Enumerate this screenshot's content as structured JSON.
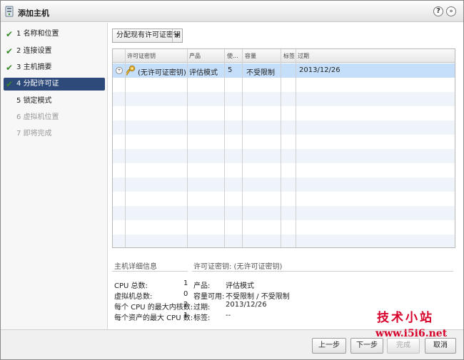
{
  "window": {
    "title": "添加主机",
    "help_icon": "?",
    "expand_icon": "»"
  },
  "steps": [
    {
      "num": "1",
      "label": "名称和位置",
      "state": "done"
    },
    {
      "num": "2",
      "label": "连接设置",
      "state": "done"
    },
    {
      "num": "3",
      "label": "主机摘要",
      "state": "done"
    },
    {
      "num": "4",
      "label": "分配许可证",
      "state": "active"
    },
    {
      "num": "5",
      "label": "锁定模式",
      "state": "pending"
    },
    {
      "num": "6",
      "label": "虚拟机位置",
      "state": "disabled"
    },
    {
      "num": "7",
      "label": "即将完成",
      "state": "disabled"
    }
  ],
  "check_mark": "✔",
  "dropdown": {
    "label": "分配现有许可证密钥",
    "arrow": "▼"
  },
  "grid": {
    "columns": [
      "许可证密钥",
      "产品",
      "使...",
      "容量",
      "标签",
      "过期"
    ],
    "rows": [
      {
        "expander": "+",
        "key": "(无许可证密钥)",
        "product": "评估模式",
        "used": "5",
        "capacity": "不受限制",
        "label": "",
        "expires": "2013/12/26"
      }
    ]
  },
  "host_details": {
    "title": "主机详细信息",
    "items": [
      {
        "label": "CPU 总数:",
        "value": "1"
      },
      {
        "label": "虚拟机总数:",
        "value": "0"
      },
      {
        "label": "每个 CPU 的最大内核数:",
        "value": "2"
      },
      {
        "label": "每个资产的最大 CPU 数:",
        "value": "1"
      }
    ]
  },
  "license_details": {
    "title": "许可证密钥: (无许可证密钥)",
    "items": [
      {
        "label": "产品:",
        "value": "评估模式"
      },
      {
        "label": "容量可用:",
        "value": "不受限制 / 不受限制"
      },
      {
        "label": "过期:",
        "value": "2013/12/26"
      },
      {
        "label": "标签:",
        "value": "--"
      }
    ]
  },
  "buttons": {
    "back": "上一步",
    "next": "下一步",
    "finish": "完成",
    "cancel": "取消"
  },
  "watermark": {
    "line1": "技术小站",
    "line2": "www.i5i6.net"
  },
  "colors": {
    "active_step": "#2d4a7a",
    "selected_row": "#c5dffa",
    "check": "#3a8a2a",
    "watermark": "#d6002a"
  }
}
